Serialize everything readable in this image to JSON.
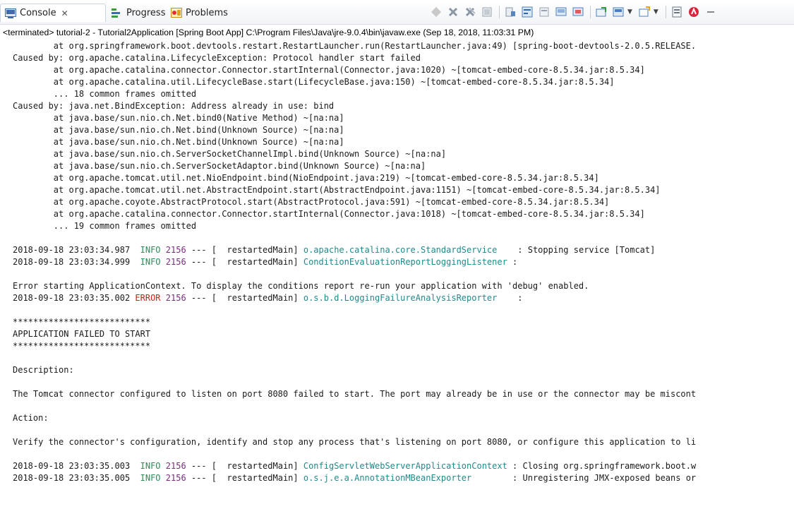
{
  "tabs": [
    {
      "label": "Console",
      "icon": "console-icon",
      "active": true
    },
    {
      "label": "Progress",
      "icon": "progress-icon",
      "active": false
    },
    {
      "label": "Problems",
      "icon": "problems-icon",
      "active": false
    }
  ],
  "toolbar_icons": [
    "terminate-icon",
    "remove-launch-icon",
    "remove-all-terminated-icon",
    "clear-console-icon",
    "scroll-lock-icon",
    "word-wrap-icon",
    "show-stdout-icon",
    "show-stderr-icon",
    "pin-console-icon",
    "display-selected-console-icon",
    "open-console-icon",
    "new-console-icon",
    "error-log-icon",
    "minimize-icon",
    "maximize-icon"
  ],
  "process_label": "<terminated> tutorial-2 - Tutorial2Application [Spring Boot App] C:\\Program Files\\Java\\jre-9.0.4\\bin\\javaw.exe (Sep 18, 2018, 11:03:31 PM)",
  "stack_lines": [
    "        at org.springframework.boot.devtools.restart.RestartLauncher.run(RestartLauncher.java:49) [spring-boot-devtools-2.0.5.RELEASE.",
    "Caused by: org.apache.catalina.LifecycleException: Protocol handler start failed",
    "        at org.apache.catalina.connector.Connector.startInternal(Connector.java:1020) ~[tomcat-embed-core-8.5.34.jar:8.5.34]",
    "        at org.apache.catalina.util.LifecycleBase.start(LifecycleBase.java:150) ~[tomcat-embed-core-8.5.34.jar:8.5.34]",
    "        ... 18 common frames omitted",
    "Caused by: java.net.BindException: Address already in use: bind",
    "        at java.base/sun.nio.ch.Net.bind0(Native Method) ~[na:na]",
    "        at java.base/sun.nio.ch.Net.bind(Unknown Source) ~[na:na]",
    "        at java.base/sun.nio.ch.Net.bind(Unknown Source) ~[na:na]",
    "        at java.base/sun.nio.ch.ServerSocketChannelImpl.bind(Unknown Source) ~[na:na]",
    "        at java.base/sun.nio.ch.ServerSocketAdaptor.bind(Unknown Source) ~[na:na]",
    "        at org.apache.tomcat.util.net.NioEndpoint.bind(NioEndpoint.java:219) ~[tomcat-embed-core-8.5.34.jar:8.5.34]",
    "        at org.apache.tomcat.util.net.AbstractEndpoint.start(AbstractEndpoint.java:1151) ~[tomcat-embed-core-8.5.34.jar:8.5.34]",
    "        at org.apache.coyote.AbstractProtocol.start(AbstractProtocol.java:591) ~[tomcat-embed-core-8.5.34.jar:8.5.34]",
    "        at org.apache.catalina.connector.Connector.startInternal(Connector.java:1018) ~[tomcat-embed-core-8.5.34.jar:8.5.34]",
    "        ... 19 common frames omitted"
  ],
  "log1": {
    "ts": "2018-09-18 23:03:34.987",
    "level": "INFO",
    "pid": "2156",
    "sep": " --- [  restartedMain] ",
    "logger": "o.apache.catalina.core.StandardService   ",
    "msg": " : Stopping service [Tomcat]"
  },
  "log2": {
    "ts": "2018-09-18 23:03:34.999",
    "level": "INFO",
    "pid": "2156",
    "sep": " --- [  restartedMain] ",
    "logger": "ConditionEvaluationReportLoggingListener",
    "msg": " :"
  },
  "error_context": "Error starting ApplicationContext. To display the conditions report re-run your application with 'debug' enabled.",
  "log3": {
    "ts": "2018-09-18 23:03:35.002",
    "level": "ERROR",
    "pid": "2156",
    "sep": " --- [  restartedMain] ",
    "logger": "o.s.b.d.LoggingFailureAnalysisReporter   ",
    "msg": " :"
  },
  "banner_stars": "***************************",
  "banner_title": "APPLICATION FAILED TO START",
  "description_heading": "Description:",
  "description_text": "The Tomcat connector configured to listen on port 8080 failed to start. The port may already be in use or the connector may be miscont",
  "action_heading": "Action:",
  "action_text": "Verify the connector's configuration, identify and stop any process that's listening on port 8080, or configure this application to li",
  "log4": {
    "ts": "2018-09-18 23:03:35.003",
    "level": "INFO",
    "pid": "2156",
    "sep": " --- [  restartedMain] ",
    "logger": "ConfigServletWebServerApplicationContext",
    "msg": " : Closing org.springframework.boot.w"
  },
  "log5": {
    "ts": "2018-09-18 23:03:35.005",
    "level": "INFO",
    "pid": "2156",
    "sep": " --- [  restartedMain] ",
    "logger": "o.s.j.e.a.AnnotationMBeanExporter       ",
    "msg": " : Unregistering JMX-exposed beans or"
  },
  "colors": {
    "info": "#2e8b57",
    "error": "#d21a1a",
    "pid": "#7a2c7f",
    "logger": "#1f8a8a"
  }
}
